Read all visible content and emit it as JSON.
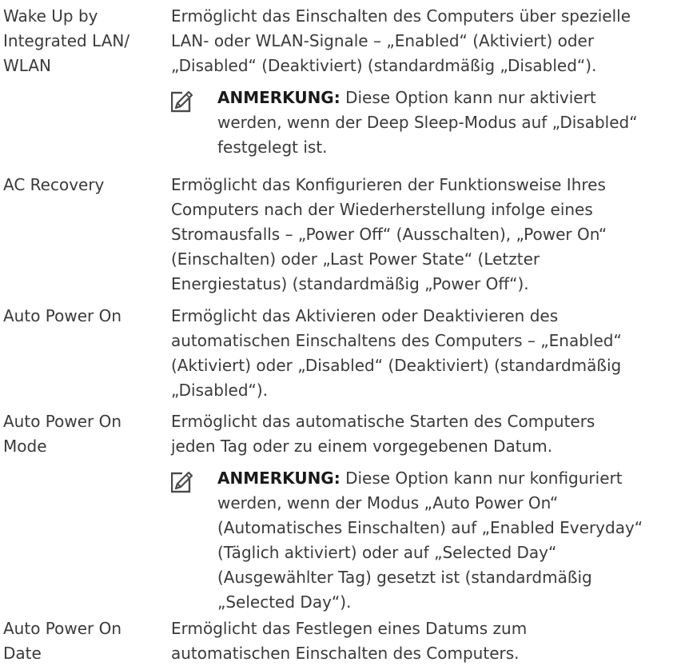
{
  "entries": [
    {
      "term": "Wake Up by\nIntegrated LAN/\nWLAN",
      "description": "Ermöglicht das Einschalten des Computers über spezielle\nLAN- oder WLAN-Signale – „Enabled“ (Aktiviert) oder\n„Disabled“ (Deaktiviert) (standardmäßig „Disabled“)."
    },
    {
      "term": "AC Recovery",
      "description": "Ermöglicht das Konfigurieren der Funktionsweise Ihres\nComputers nach der Wiederherstellung infolge eines\nStromausfalls – „Power Off“ (Ausschalten), „Power On“\n(Einschalten) oder „Last Power State“ (Letzter\nEnergiestatus) (standardmäßig „Power Off“)."
    },
    {
      "term": "Auto Power On",
      "description": "Ermöglicht das Aktivieren oder Deaktivieren des\nautomatischen Einschaltens des Computers – „Enabled“\n(Aktiviert) oder „Disabled“ (Deaktiviert) (standardmäßig\n„Disabled“)."
    },
    {
      "term": "Auto Power On\nMode",
      "description": "Ermöglicht das automatische Starten des Computers\njeden Tag oder zu einem vorgegebenen Datum."
    },
    {
      "term": "Auto Power On\nDate",
      "description": "Ermöglicht das Festlegen eines Datums zum\nautomatischen Einschalten des Computers."
    }
  ],
  "notes": [
    {
      "icon": "pencil-note-icon",
      "label": "ANMERKUNG:",
      "text": " Diese Option kann nur aktiviert\nwerden, wenn der Deep Sleep-Modus auf „Disabled“\nfestgelegt ist."
    },
    {
      "icon": "pencil-note-icon",
      "label": "ANMERKUNG:",
      "text": " Diese Option kann nur konfiguriert\nwerden, wenn der Modus „Auto Power On“\n(Automatisches Einschalten) auf „Enabled Everyday“\n(Täglich aktiviert) oder auf „Selected Day“\n(Ausgewählter Tag) gesetzt ist (standardmäßig\n„Selected Day“)."
    }
  ]
}
